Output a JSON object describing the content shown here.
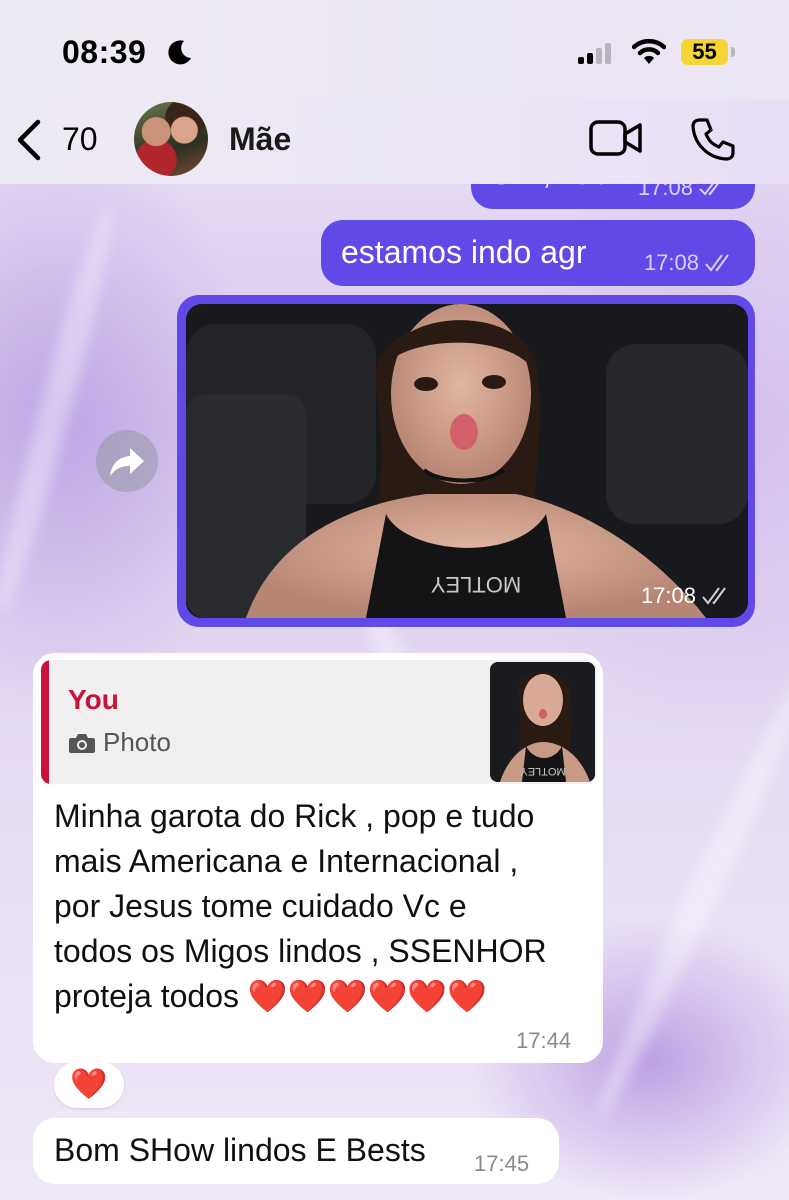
{
  "status_bar": {
    "time": "08:39",
    "battery": "55",
    "icons": [
      "moon-icon",
      "signal-icon",
      "wifi-icon",
      "battery-icon"
    ]
  },
  "header": {
    "back_count": "70",
    "contact_name": "Mãe",
    "icons": [
      "chevron-left-icon",
      "video-call-icon",
      "phone-icon"
    ]
  },
  "colors": {
    "outgoing_bubble": "#6049e6",
    "incoming_bubble": "#ffffff",
    "quote_accent": "#c8123a",
    "battery_accent": "#f5d534"
  },
  "messages": [
    {
      "type": "outgoing_text",
      "text": "Sim, não",
      "time": "17:08",
      "status": "read"
    },
    {
      "type": "outgoing_text",
      "text": "estamos indo agr",
      "time": "17:08",
      "status": "read"
    },
    {
      "type": "outgoing_photo",
      "time": "17:08",
      "status": "read",
      "photo_print": "MOTLEY"
    },
    {
      "type": "incoming_text",
      "reply_to": {
        "name": "You",
        "label": "Photo",
        "thumb_print": "MOTLEY"
      },
      "lines": [
        "Minha garota do Rick , pop e tudo",
        "mais Americana e Internacional ,",
        "por Jesus tome cuidado Vc e",
        "todos os Migos lindos , SSENHOR",
        "proteja todos ❤️❤️❤️❤️❤️❤️"
      ],
      "time": "17:44",
      "reaction": "❤️"
    },
    {
      "type": "incoming_text",
      "text": "Bom SHow lindos E Bests",
      "time": "17:45"
    }
  ]
}
